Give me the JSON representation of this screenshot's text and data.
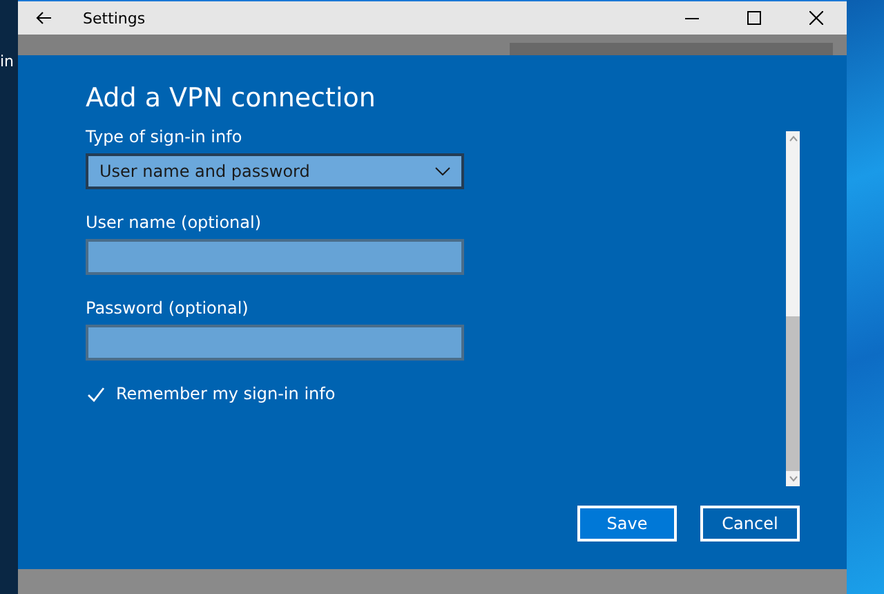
{
  "desktop": {
    "icon_label": "in"
  },
  "window": {
    "title": "Settings"
  },
  "dialog": {
    "title": "Add a VPN connection",
    "fields": [
      {
        "kind": "dropdown",
        "label": "Type of sign-in info",
        "value": "User name and password"
      },
      {
        "kind": "text",
        "label": "User name (optional)"
      },
      {
        "kind": "password",
        "label": "Password (optional)"
      }
    ],
    "remember": {
      "label": "Remember my sign-in info",
      "checked": true
    },
    "buttons": [
      {
        "label": "Save",
        "primary": true
      },
      {
        "label": "Cancel",
        "primary": false
      }
    ]
  }
}
